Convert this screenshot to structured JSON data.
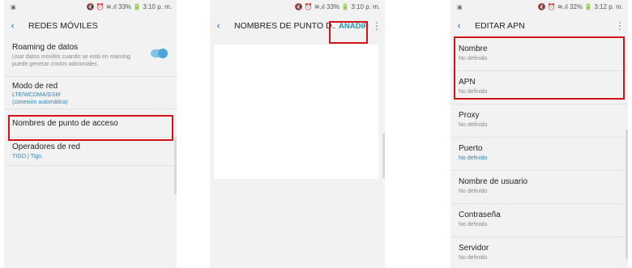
{
  "screens": [
    {
      "status": {
        "left_icon": "▣",
        "right": "🔇 ⏰ ≋.ıl 33% 🔋 3:10 p. m."
      },
      "title": "REDES MÓVILES",
      "items": [
        {
          "title": "Roaming de datos",
          "subtitle": "Usar datos móviles cuando se está en roaming puede generar costos adicionales.",
          "toggle": true
        },
        {
          "title": "Modo de red",
          "subtitle": "LTE/WCDMA/GSM",
          "subtitle2": "(conexión automática)"
        },
        {
          "title": "Nombres de punto de acceso"
        },
        {
          "title": "Operadores de red",
          "subtitle": "TIGO | Tigo"
        }
      ]
    },
    {
      "status": {
        "left_icon": "",
        "right": "🔇 ⏰ ≋.ıl 33% 🔋 3:10 p. m."
      },
      "title": "NOMBRES DE PUNTO D...",
      "action": "AÑADIR",
      "more": "⋮"
    },
    {
      "status": {
        "left_icon": "▣",
        "right": "🔇 ⏰ ≋.ıl 32% 🔋 3:12 p. m."
      },
      "title": "EDITAR APN",
      "more": "⋮",
      "items": [
        {
          "title": "Nombre",
          "subtitle": "No definido"
        },
        {
          "title": "APN",
          "subtitle": "No definido"
        },
        {
          "title": "Proxy",
          "subtitle": "No definido"
        },
        {
          "title": "Puerto",
          "subtitle": "No definido"
        },
        {
          "title": "Nombre de usuario",
          "subtitle": "No definido"
        },
        {
          "title": "Contraseña",
          "subtitle": "No definido"
        },
        {
          "title": "Servidor",
          "subtitle": "No definido"
        }
      ]
    }
  ],
  "icons": {
    "back": "chevron-left-icon",
    "more": "more-vert-icon"
  },
  "colors": {
    "highlight": "#d0151b",
    "accent": "#2f8fb0",
    "background": "#f2f2f2"
  }
}
